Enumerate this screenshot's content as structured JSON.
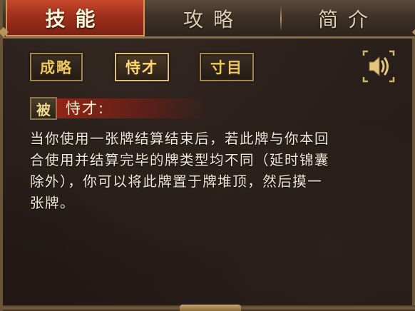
{
  "tabs": [
    {
      "label": "技能",
      "active": true
    },
    {
      "label": "攻略",
      "active": false
    },
    {
      "label": "简介",
      "active": false
    }
  ],
  "skill_buttons": [
    {
      "label": "成略",
      "active": false
    },
    {
      "label": "恃才",
      "active": true
    },
    {
      "label": "寸目",
      "active": false
    }
  ],
  "sound_button": {
    "icon": "speaker-icon"
  },
  "skill": {
    "type_badge": "被",
    "name": "恃才:",
    "description_lines": [
      "当你使用一张牌结算结束后，若此牌与你本回",
      "合使用并结算完毕的牌类型均不同（延时锦囊",
      "除外），你可以将此牌置于牌堆顶，然后摸一",
      "张牌。"
    ]
  },
  "colors": {
    "active_tab": "#a0301c",
    "button_text": "#f1c85a",
    "gold_frame": "#a9854d",
    "title_ribbon": "#962418"
  }
}
